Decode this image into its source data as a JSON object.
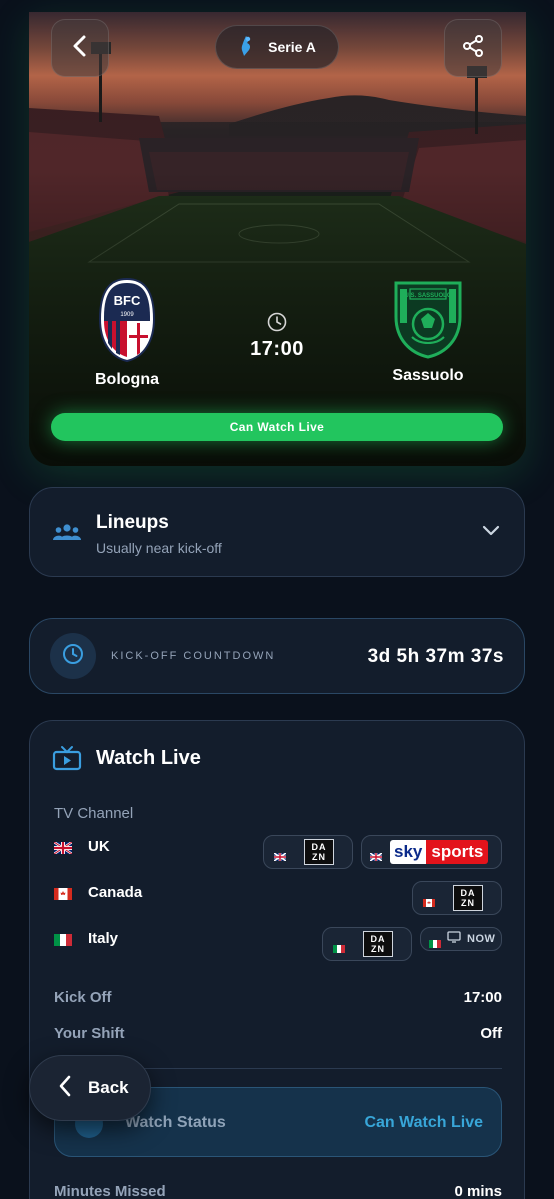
{
  "header": {
    "league": "Serie A"
  },
  "match": {
    "home_team": "Bologna",
    "away_team": "Sassuolo",
    "kickoff_time": "17:00",
    "watch_button": "Can Watch Live",
    "home_crest_text": "BFC",
    "home_crest_year": "1909",
    "away_crest_text": "U.S. SASSUOLO"
  },
  "lineups": {
    "title": "Lineups",
    "subtitle": "Usually near kick-off"
  },
  "countdown": {
    "label": "KICK-OFF COUNTDOWN",
    "value": "3d 5h 37m 37s"
  },
  "watch_live": {
    "title": "Watch Live",
    "tv_channel_label": "TV Channel",
    "countries": [
      {
        "name": "UK",
        "channels": [
          "DAZN",
          "sky sports"
        ]
      },
      {
        "name": "Canada",
        "channels": [
          "DAZN"
        ]
      },
      {
        "name": "Italy",
        "channels": [
          "DAZN",
          "NOW"
        ]
      }
    ],
    "dazn_top": "DA",
    "dazn_bottom": "ZN",
    "sky_a": "sky",
    "sky_b": "sports",
    "now_label": "NOW",
    "kick_off_label": "Kick Off",
    "kick_off_value": "17:00",
    "shift_label": "Your Shift",
    "shift_value": "Off",
    "status_label": "Watch Status",
    "status_value": "Can Watch Live",
    "minutes_missed_label": "Minutes Missed",
    "minutes_missed_value": "0 mins"
  },
  "floating": {
    "back_label": "Back"
  },
  "colors": {
    "background": "#0a111c",
    "card": "#131d2c",
    "accent_green": "#22c55e",
    "accent_blue": "#38a6d8",
    "muted": "#94a3b8"
  }
}
